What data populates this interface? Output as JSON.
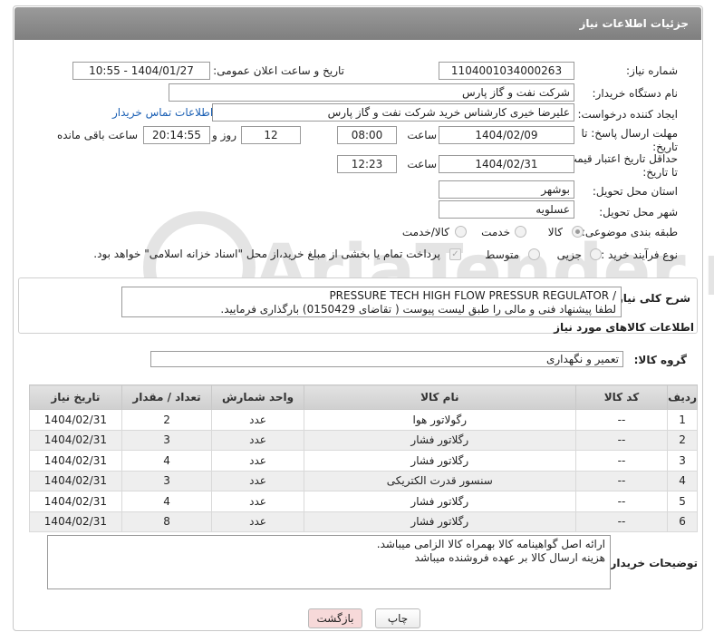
{
  "header": {
    "title": "جزئیات اطلاعات نیاز"
  },
  "form": {
    "need_number_label": "شماره نیاز:",
    "need_number": "1104001034000263",
    "announce_label": "تاریخ و ساعت اعلان عمومی:",
    "announce_value": "1404/01/27 - 10:55",
    "buyer_org_label": "نام دستگاه خریدار:",
    "buyer_org": "شرکت نفت و گاز پارس",
    "creator_label": "ایجاد کننده درخواست:",
    "creator": "علیرضا  خیری کارشناس خرید  شرکت نفت و گاز پارس",
    "contact_link": "اطلاعات تماس خریدار",
    "reply_deadline_label_1": "مهلت ارسال پاسخ: تا",
    "reply_deadline_label_2": "تاریخ:",
    "reply_date": "1404/02/09",
    "time_label": "ساعت",
    "reply_time": "08:00",
    "days": "12",
    "days_label": "روز و",
    "remaining": "20:14:55",
    "remaining_label": "ساعت باقی مانده",
    "price_deadline_label_1": "حداقل تاریخ اعتبار قیمت:",
    "price_deadline_label_2": "تا تاریخ:",
    "price_date": "1404/02/31",
    "price_time": "12:23",
    "province_label": "استان محل تحویل:",
    "province": "بوشهر",
    "city_label": "شهر محل تحویل:",
    "city": "عسلویه",
    "category_label": "طبقه بندی موضوعی:",
    "category_options": [
      "کالا",
      "خدمت",
      "کالا/خدمت"
    ],
    "process_label": "نوع فرآیند خرید :",
    "process_options": [
      "جزیی",
      "متوسط"
    ],
    "payment_note": "پرداخت تمام یا بخشی از مبلغ خرید،از محل \"اسناد خزانه اسلامی\" خواهد بود."
  },
  "summary": {
    "label": "شرح کلی نیاز:",
    "line1": "PRESSURE TECH HIGH FLOW PRESSUR REGULATOR /",
    "line2": "لطفا پیشنهاد فنی و مالی را طبق لیست پیوست ( تقاضای 0150429) بارگذاری فرمایید."
  },
  "goods": {
    "section_title": "اطلاعات کالاهای مورد نیاز",
    "group_label": "گروه کالا:",
    "group_value": "تعمیر و نگهداری",
    "columns": [
      "ردیف",
      "کد کالا",
      "نام کالا",
      "واحد شمارش",
      "تعداد / مقدار",
      "تاریخ نیاز"
    ],
    "rows": [
      {
        "row": "1",
        "code": "--",
        "name": "رگولاتور هوا",
        "unit": "عدد",
        "qty": "2",
        "date": "1404/02/31"
      },
      {
        "row": "2",
        "code": "--",
        "name": "رگلاتور فشار",
        "unit": "عدد",
        "qty": "3",
        "date": "1404/02/31"
      },
      {
        "row": "3",
        "code": "--",
        "name": "رگلاتور فشار",
        "unit": "عدد",
        "qty": "4",
        "date": "1404/02/31"
      },
      {
        "row": "4",
        "code": "--",
        "name": "سنسور قدرت الکتریکی",
        "unit": "عدد",
        "qty": "3",
        "date": "1404/02/31"
      },
      {
        "row": "5",
        "code": "--",
        "name": "رگلاتور فشار",
        "unit": "عدد",
        "qty": "4",
        "date": "1404/02/31"
      },
      {
        "row": "6",
        "code": "--",
        "name": "رگلاتور فشار",
        "unit": "عدد",
        "qty": "8",
        "date": "1404/02/31"
      }
    ]
  },
  "buyer_notes": {
    "label": "توضیحات خریدار:",
    "line1": "ارائه اصل گواهینامه کالا بهمراه کالا الزامی میباشد.",
    "line2": "هزینه ارسال کالا بر عهده فروشنده میباشد"
  },
  "buttons": {
    "print": "چاپ",
    "back": "بازگشت"
  },
  "watermark": {
    "text": "AriaTender.neT"
  },
  "colors": {
    "header_bg": "#8a8a8a",
    "link": "#1a5fb4",
    "back_btn_bg": "#f7d9d9"
  }
}
